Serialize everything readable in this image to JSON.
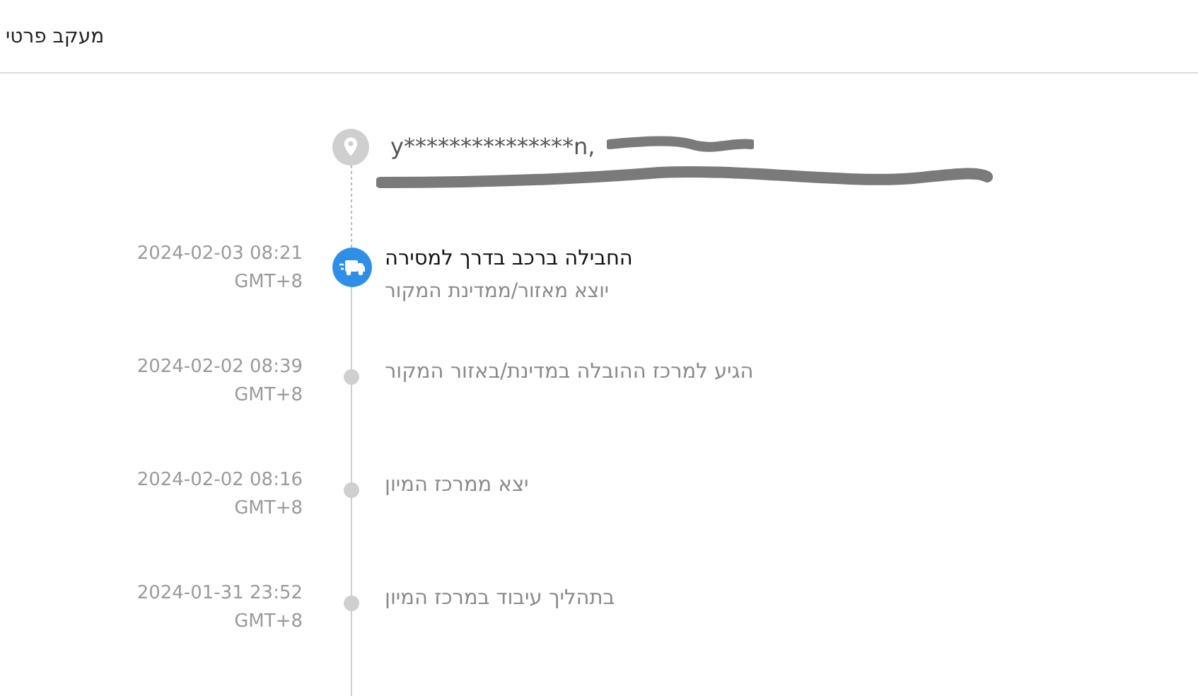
{
  "header": {
    "title": "מעקב פרטי"
  },
  "address": {
    "line": "y***************n,",
    "redacted": true
  },
  "events": [
    {
      "date": "2024-02-03 08:21",
      "zone": "GMT+8",
      "title": "החבילה ברכב בדרך למסירה",
      "detail": "יוצא מאזור/ממדינת המקור",
      "active": true
    },
    {
      "date": "2024-02-02 08:39",
      "zone": "GMT+8",
      "title": "הגיע למרכז ההובלה במדינת/באזור המקור",
      "active": false
    },
    {
      "date": "2024-02-02 08:16",
      "zone": "GMT+8",
      "title": "יצא ממרכז המיון",
      "active": false
    },
    {
      "date": "2024-01-31 23:52",
      "zone": "GMT+8",
      "title": "בתהליך עיבוד במרכז המיון",
      "active": false
    }
  ]
}
